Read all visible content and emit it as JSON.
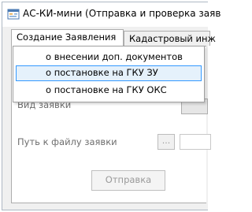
{
  "window": {
    "title": "АС-КИ-мини (Отправка и проверка заяв"
  },
  "tabs": [
    {
      "label": "Создание Заявления",
      "active": true
    },
    {
      "label": "Кадастровый инж",
      "active": false
    }
  ],
  "menu": {
    "items": [
      {
        "label": "о внесении доп. документов",
        "selected": false
      },
      {
        "label": "о постановке на ГКУ ЗУ",
        "selected": true
      },
      {
        "label": "о постановке на ГКУ ОКС",
        "selected": false
      }
    ]
  },
  "form": {
    "request_type_label": "Вид заявки",
    "file_path_label": "Путь к файлу заявки",
    "browse_label": "...",
    "send_label": "Отправка"
  },
  "colors": {
    "selection_fill": "#e5f1fb",
    "selection_border": "#3399ff",
    "disabled_text": "#9a9a9a"
  },
  "icons": {
    "app": "app-form-icon"
  }
}
